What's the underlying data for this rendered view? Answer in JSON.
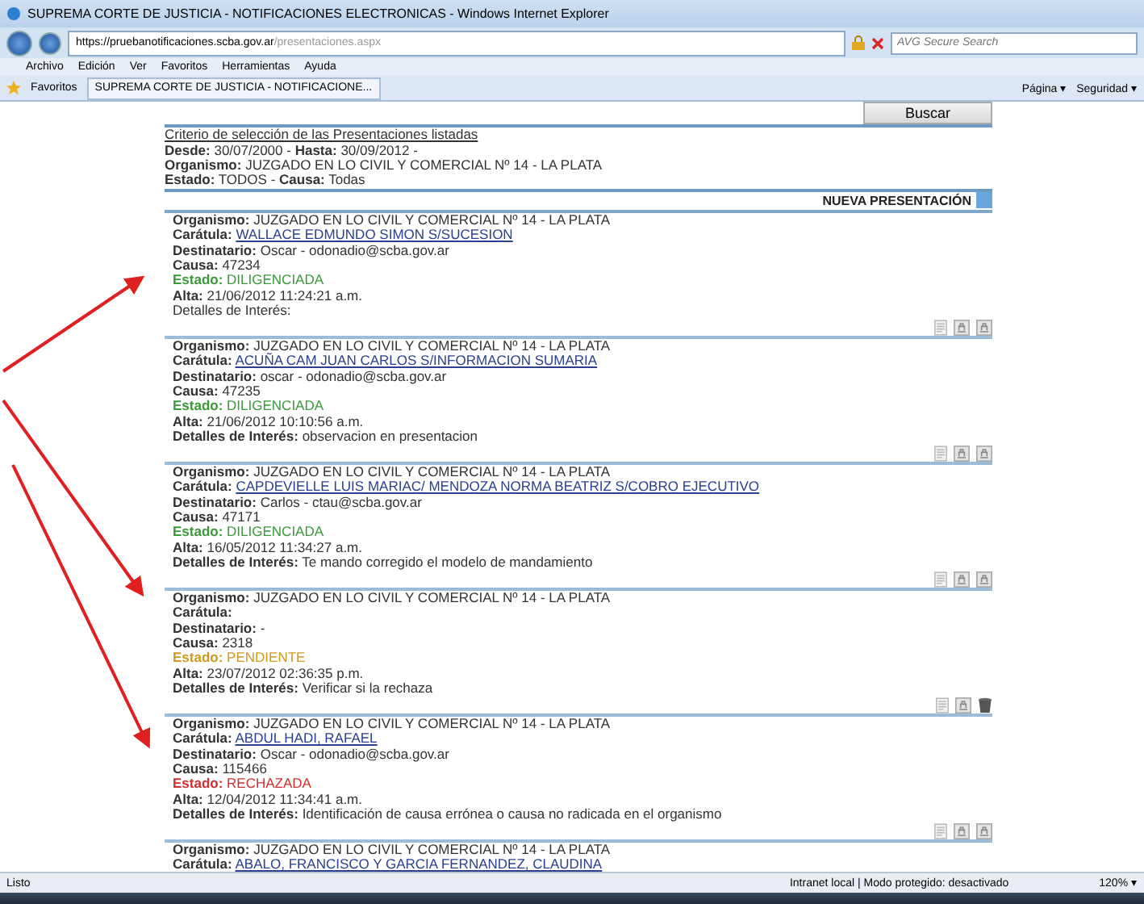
{
  "window": {
    "title": "SUPREMA CORTE DE JUSTICIA - NOTIFICACIONES ELECTRONICAS - Windows Internet Explorer"
  },
  "address": {
    "host": "https://pruebanotificaciones.scba.gov.ar",
    "path": "/presentaciones.aspx"
  },
  "search": {
    "placeholder": "AVG Secure Search"
  },
  "menu": [
    "Archivo",
    "Edición",
    "Ver",
    "Favoritos",
    "Herramientas",
    "Ayuda"
  ],
  "favorites": {
    "label": "Favoritos",
    "tab": "SUPREMA CORTE DE JUSTICIA - NOTIFICACIONE...",
    "commands": [
      {
        "label": "Página",
        "caret": "▾"
      },
      {
        "label": "Seguridad",
        "caret": "▾"
      }
    ]
  },
  "search_button": "Buscar",
  "criteria": {
    "title": "Criterio de selección de las Presentaciones listadas",
    "lines": [
      [
        {
          "label": "Desde:",
          "value": "30/07/2000 -"
        },
        {
          "label": "Hasta:",
          "value": "30/09/2012 -"
        }
      ],
      [
        {
          "label": "Organismo:",
          "value": "JUZGADO EN LO CIVIL Y COMERCIAL Nº 14 - LA PLATA"
        }
      ],
      [
        {
          "label": "Estado:",
          "value": "TODOS -"
        },
        {
          "label": "Causa:",
          "value": "Todas"
        }
      ]
    ]
  },
  "new_button": "NUEVA PRESENTACIÓN",
  "records": [
    {
      "deletable": false,
      "fields": [
        {
          "kind": "text",
          "text": "**Organismo:** JUZGADO EN LO CIVIL Y COMERCIAL Nº 14 - LA PLATA"
        },
        {
          "kind": "link",
          "label": "Carátula:",
          "value": "WALLACE EDMUNDO SIMON S/SUCESION"
        },
        {
          "kind": "text",
          "text": "**Destinatario:** Oscar - odonadio@scba.gov.ar"
        },
        {
          "kind": "text",
          "text": "**Causa:** 47234"
        },
        {
          "kind": "status",
          "label": "Estado:",
          "value": "DILIGENCIADA",
          "color": "#3a9a3a"
        },
        {
          "kind": "text",
          "text": "**Alta:** 21/06/2012 11:24:21 a.m."
        },
        {
          "kind": "text",
          "text": "Detalles de Interés:"
        }
      ]
    },
    {
      "deletable": false,
      "fields": [
        {
          "kind": "text",
          "text": "**Organismo:** JUZGADO EN LO CIVIL Y COMERCIAL Nº 14 - LA PLATA"
        },
        {
          "kind": "link",
          "label": "Carátula:",
          "value": "ACUÑA CAM JUAN CARLOS S/INFORMACION SUMARIA"
        },
        {
          "kind": "text",
          "text": "**Destinatario:** oscar - odonadio@scba.gov.ar"
        },
        {
          "kind": "text",
          "text": "**Causa:** 47235"
        },
        {
          "kind": "status",
          "label": "Estado:",
          "value": "DILIGENCIADA",
          "color": "#3a9a3a"
        },
        {
          "kind": "text",
          "text": "**Alta:** 21/06/2012 10:10:56 a.m."
        },
        {
          "kind": "text",
          "text": "**Detalles de Interés:** observacion en presentacion"
        }
      ]
    },
    {
      "deletable": false,
      "fields": [
        {
          "kind": "text",
          "text": "**Organismo:** JUZGADO EN LO CIVIL Y COMERCIAL Nº 14 - LA PLATA"
        },
        {
          "kind": "link",
          "label": "Carátula:",
          "value": "CAPDEVIELLE LUIS MARIAC/ MENDOZA NORMA BEATRIZ S/COBRO EJECUTIVO"
        },
        {
          "kind": "text",
          "text": "**Destinatario:** Carlos - ctau@scba.gov.ar"
        },
        {
          "kind": "text",
          "text": "**Causa:** 47171"
        },
        {
          "kind": "status",
          "label": "Estado:",
          "value": "DILIGENCIADA",
          "color": "#3a9a3a"
        },
        {
          "kind": "text",
          "text": "**Alta:** 16/05/2012 11:34:27 a.m."
        },
        {
          "kind": "text",
          "text": "**Detalles de Interés:** Te mando corregido el modelo de mandamiento"
        }
      ]
    },
    {
      "deletable": true,
      "fields": [
        {
          "kind": "text",
          "text": "**Organismo:** JUZGADO EN LO CIVIL Y COMERCIAL Nº 14 - LA PLATA"
        },
        {
          "kind": "link",
          "label": "Carátula:"
        },
        {
          "kind": "text",
          "text": "**Destinatario:** -"
        },
        {
          "kind": "text",
          "text": "**Causa:** 2318"
        },
        {
          "kind": "status",
          "label": "Estado:",
          "value": "PENDIENTE",
          "color": "#d09a20"
        },
        {
          "kind": "text",
          "text": "**Alta:** 23/07/2012 02:36:35 p.m."
        },
        {
          "kind": "text",
          "text": "**Detalles de Interés:** Verificar si la rechaza"
        }
      ]
    },
    {
      "deletable": false,
      "fields": [
        {
          "kind": "text",
          "text": "**Organismo:** JUZGADO EN LO CIVIL Y COMERCIAL Nº 14 - LA PLATA"
        },
        {
          "kind": "link",
          "label": "Carátula:",
          "value": "ABDUL HADI, RAFAEL"
        },
        {
          "kind": "text",
          "text": "**Destinatario:** Oscar - odonadio@scba.gov.ar"
        },
        {
          "kind": "text",
          "text": "**Causa:** 115466"
        },
        {
          "kind": "status",
          "label": "Estado:",
          "value": "RECHAZADA",
          "color": "#d03030"
        },
        {
          "kind": "text",
          "text": "**Alta:** 12/04/2012 11:34:41 a.m."
        },
        {
          "kind": "text",
          "text": "**Detalles de Interés:** Identificación de causa errónea o causa no radicada en el organismo"
        }
      ]
    },
    {
      "fields": [
        {
          "kind": "text",
          "text": "**Organismo:** JUZGADO EN LO CIVIL Y COMERCIAL Nº 14 - LA PLATA"
        },
        {
          "kind": "link",
          "label": "Carátula:",
          "value": "ABALO, FRANCISCO Y GARCIA FERNANDEZ, CLAUDINA"
        }
      ]
    }
  ],
  "status_bar": {
    "text": "Listo",
    "zone": "Intranet local | Modo protegido: desactivado",
    "zoom": "120%",
    "zoom_caret": "▾"
  }
}
